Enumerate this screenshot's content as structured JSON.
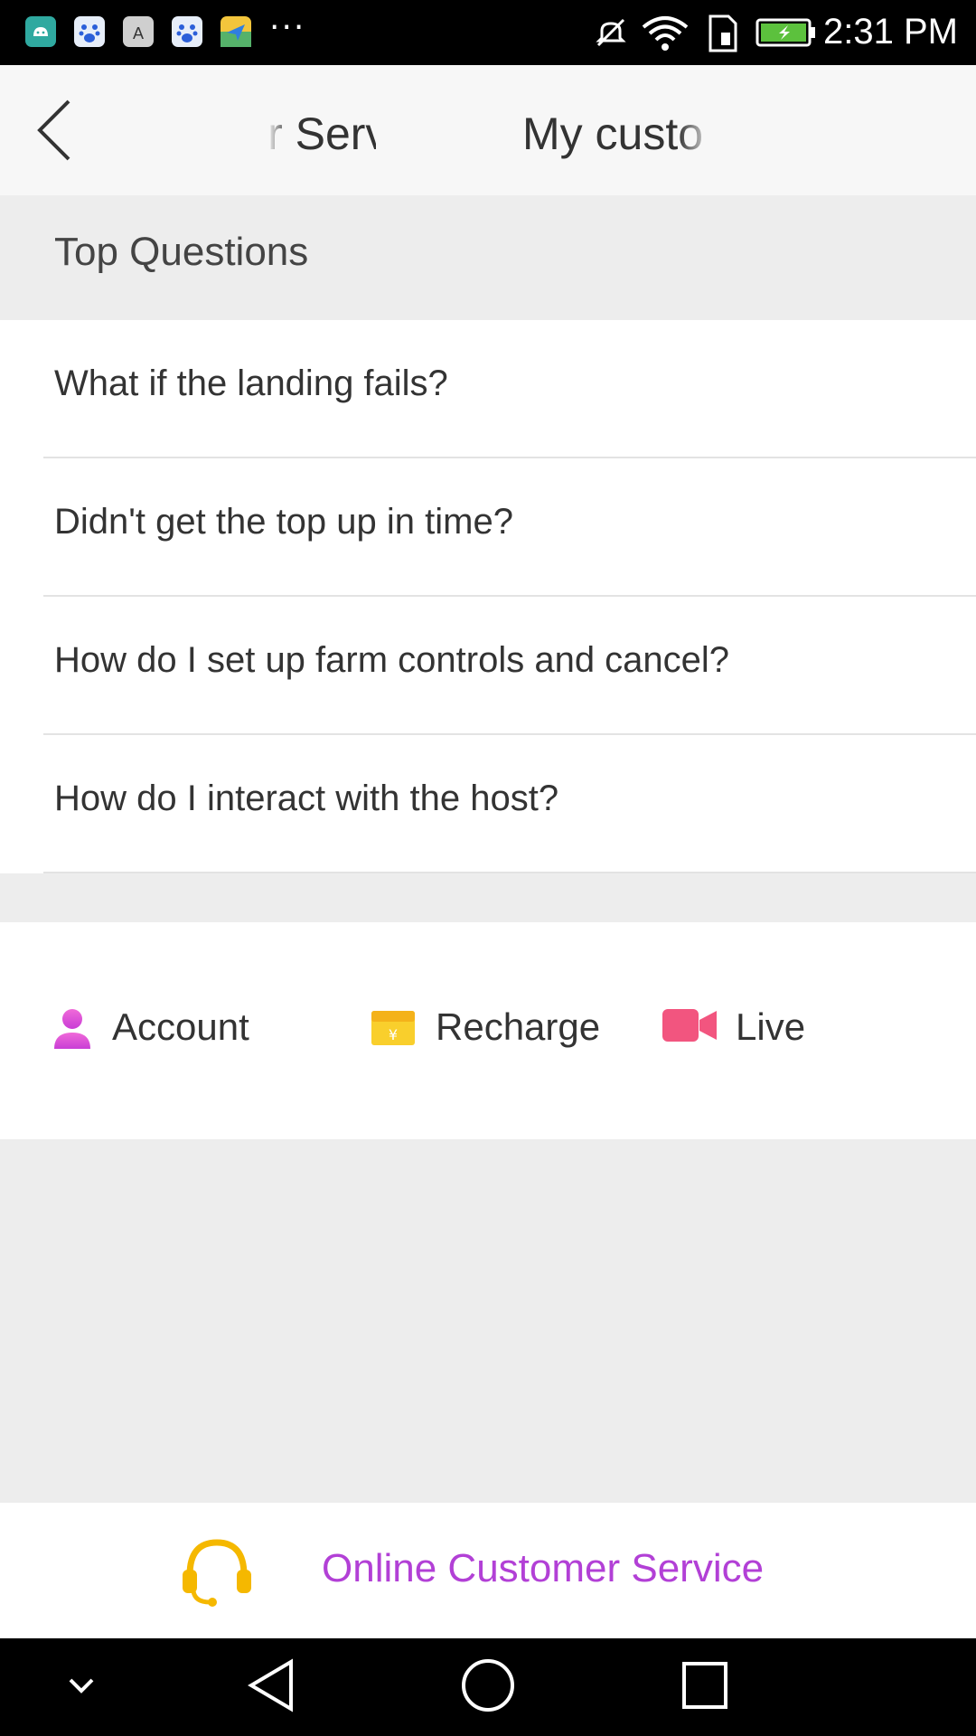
{
  "status_bar": {
    "time": "2:31 PM",
    "more": "···"
  },
  "header": {
    "tab_left": "Customer Service",
    "tab_right": "My custo"
  },
  "section": {
    "title": "Top Questions"
  },
  "questions": [
    "What if the landing fails?",
    "Didn't get the top up in time?",
    "How do I set up farm controls and cancel?",
    "How do I interact with the host?"
  ],
  "categories": {
    "account": "Account",
    "recharge": "Recharge",
    "live": "Live"
  },
  "footer": {
    "online_service": "Online Customer Service"
  },
  "colors": {
    "accent_purple": "#b240d6",
    "headset_yellow": "#f5b800",
    "account_pink": "#e04fd6",
    "recharge_yellow": "#f7c41b",
    "live_pink": "#f2557f"
  }
}
